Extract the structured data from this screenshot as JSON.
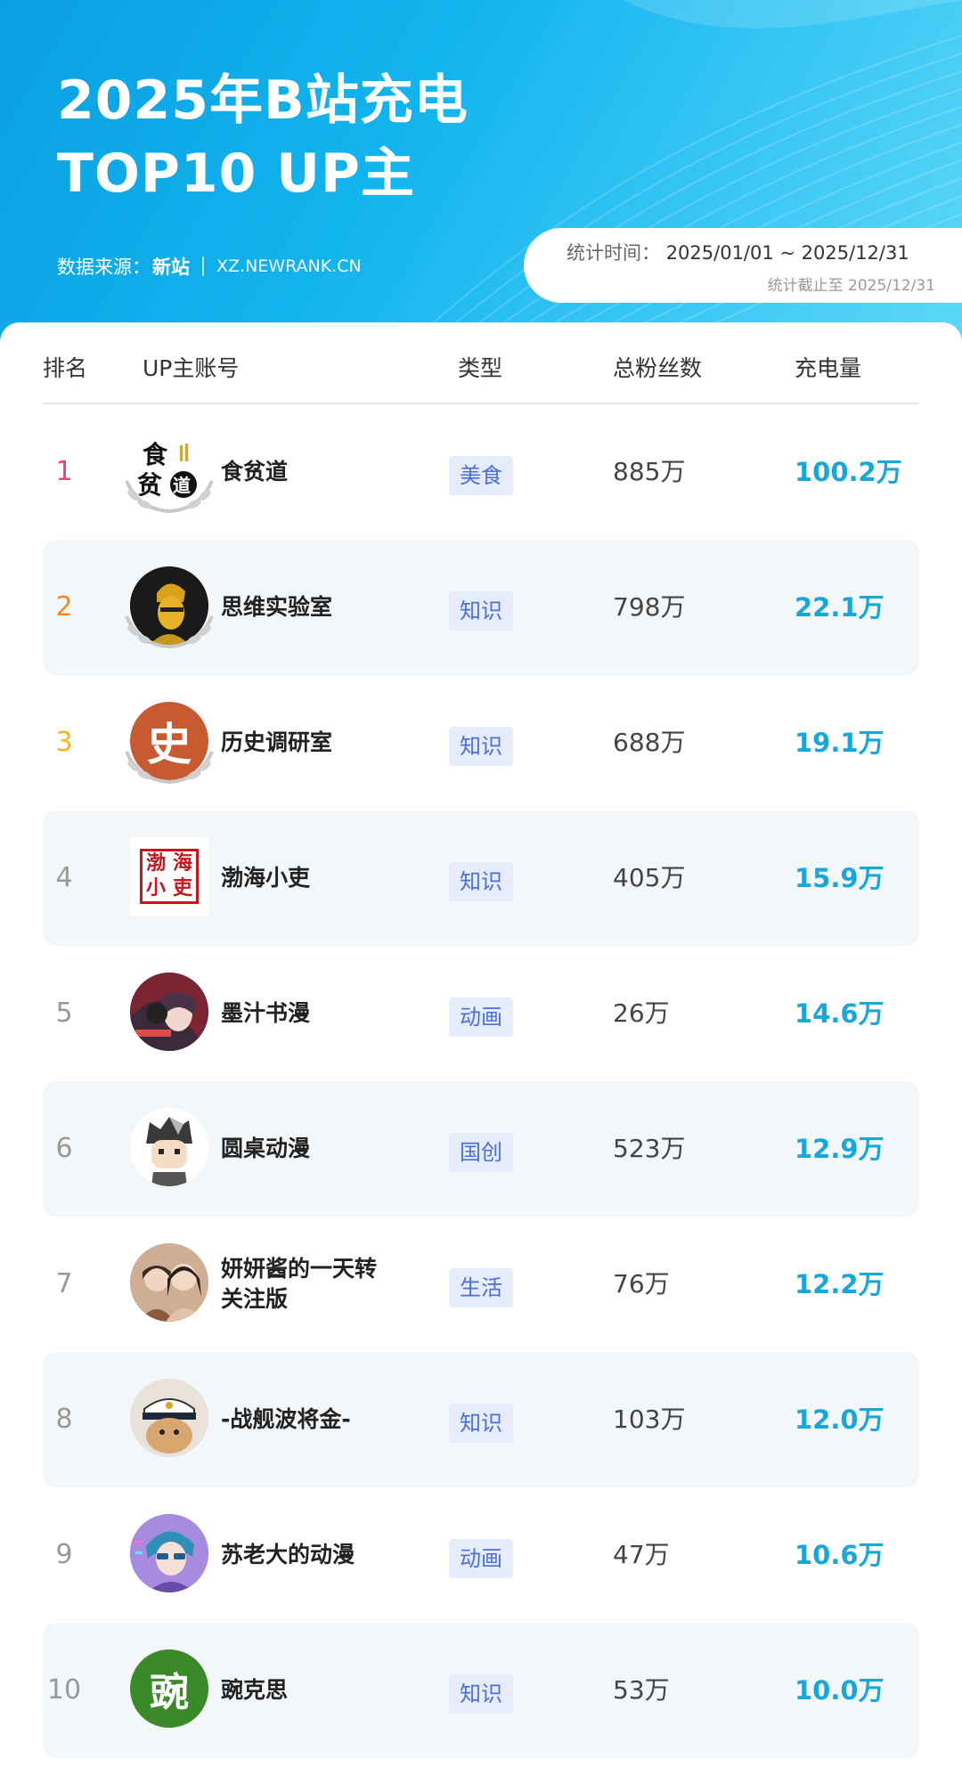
{
  "header": {
    "title_line1": "2025年B站充电",
    "title_line2": "TOP10 UP主",
    "source_label": "数据来源：",
    "source_brand": "新站",
    "source_url": "XZ.NEWRANK.CN",
    "period_label": "统计时间：",
    "period_range": "2025/01/01 ~ 2025/12/31",
    "cutoff": "统计截止至 2025/12/31"
  },
  "table": {
    "columns": [
      "排名",
      "UP主账号",
      "类型",
      "总粉丝数",
      "充电量"
    ],
    "rows": [
      {
        "rank": "1",
        "name": "食贫道",
        "type": "美食",
        "fans": "885万",
        "charge": "100.2万"
      },
      {
        "rank": "2",
        "name": "思维实验室",
        "type": "知识",
        "fans": "798万",
        "charge": "22.1万"
      },
      {
        "rank": "3",
        "name": "历史调研室",
        "type": "知识",
        "fans": "688万",
        "charge": "19.1万"
      },
      {
        "rank": "4",
        "name": "渤海小吏",
        "type": "知识",
        "fans": "405万",
        "charge": "15.9万"
      },
      {
        "rank": "5",
        "name": "墨汁书漫",
        "type": "动画",
        "fans": "26万",
        "charge": "14.6万"
      },
      {
        "rank": "6",
        "name": "圆桌动漫",
        "type": "国创",
        "fans": "523万",
        "charge": "12.9万"
      },
      {
        "rank": "7",
        "name": "妍妍酱的一天转关注版",
        "type": "生活",
        "fans": "76万",
        "charge": "12.2万"
      },
      {
        "rank": "8",
        "name": "-战舰波将金-",
        "type": "知识",
        "fans": "103万",
        "charge": "12.0万"
      },
      {
        "rank": "9",
        "name": "苏老大的动漫",
        "type": "动画",
        "fans": "47万",
        "charge": "10.6万"
      },
      {
        "rank": "10",
        "name": "豌克思",
        "type": "知识",
        "fans": "53万",
        "charge": "10.0万"
      }
    ]
  },
  "avatars": {
    "shi": "食",
    "pin": "贫",
    "dao": "道",
    "history_char": "史",
    "bohai": [
      "渤",
      "海",
      "小",
      "吏"
    ],
    "wan": "豌"
  },
  "colors": {
    "rank1": "#e8457a",
    "rank2": "#f28a1c",
    "rank3": "#f5b51e",
    "charge": "#18a8d8",
    "tag_bg": "#e6ecfb",
    "tag_text": "#4a6fd8"
  }
}
